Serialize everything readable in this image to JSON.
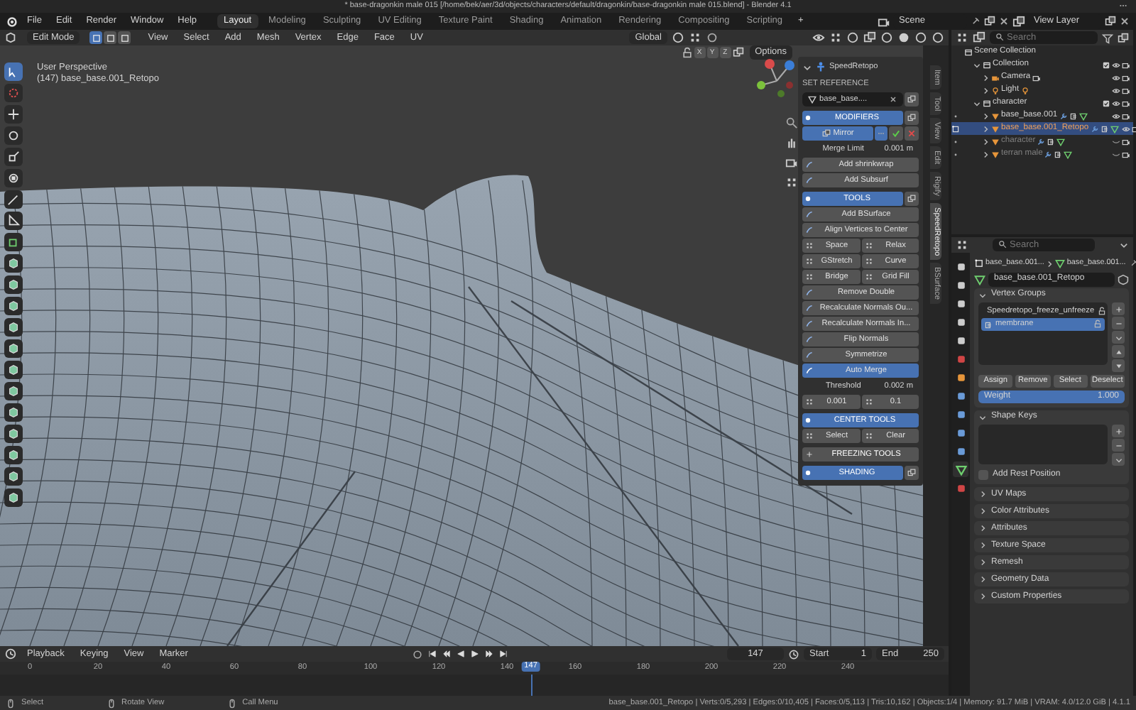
{
  "window": {
    "title": "* base-dragonkin male 015 [/home/bek/aer/3d/objects/characters/default/dragonkin/base-dragonkin male 015.blend] - Blender 4.1"
  },
  "menu": [
    "File",
    "Edit",
    "Render",
    "Window",
    "Help"
  ],
  "workspaces": [
    {
      "label": "Layout",
      "selected": true
    },
    {
      "label": "Modeling",
      "selected": false
    },
    {
      "label": "Sculpting",
      "selected": false
    },
    {
      "label": "UV Editing",
      "selected": false
    },
    {
      "label": "Texture Paint",
      "selected": false
    },
    {
      "label": "Shading",
      "selected": false
    },
    {
      "label": "Animation",
      "selected": false
    },
    {
      "label": "Rendering",
      "selected": false
    },
    {
      "label": "Compositing",
      "selected": false
    },
    {
      "label": "Scripting",
      "selected": false
    }
  ],
  "add_workspace": "+",
  "scene": {
    "scene": "Scene",
    "view_layer": "View Layer"
  },
  "viewport": {
    "mode": "Edit Mode",
    "select_modes": [
      {
        "selected": true
      },
      {
        "selected": false
      },
      {
        "selected": false
      }
    ],
    "menus": [
      "View",
      "Select",
      "Add",
      "Mesh",
      "Vertex",
      "Edge",
      "Face",
      "UV"
    ],
    "orientation": "Global",
    "axes": [
      "X",
      "Y",
      "Z"
    ],
    "options": "Options",
    "view_name": "User Perspective",
    "object_info": "(147) base_base.001_Retopo",
    "tools": [
      {
        "kind": "select",
        "selected": true
      },
      {
        "kind": "cursor",
        "selected": false
      },
      {
        "kind": "move",
        "selected": false
      },
      {
        "kind": "rotate",
        "selected": false
      },
      {
        "kind": "scale",
        "selected": false
      },
      {
        "kind": "transform",
        "selected": false
      },
      {
        "kind": "annotate",
        "selected": false
      },
      {
        "kind": "measure",
        "selected": false
      },
      {
        "kind": "add_cube",
        "selected": false
      },
      {
        "kind": "extrude",
        "selected": false
      },
      {
        "kind": "inset",
        "selected": false
      },
      {
        "kind": "bevel",
        "selected": false
      },
      {
        "kind": "loop_cut",
        "selected": false
      },
      {
        "kind": "knife",
        "selected": false
      },
      {
        "kind": "poly_build",
        "selected": false
      },
      {
        "kind": "spin",
        "selected": false
      },
      {
        "kind": "smooth",
        "selected": false
      },
      {
        "kind": "edge_slide",
        "selected": false
      },
      {
        "kind": "shrink",
        "selected": false
      },
      {
        "kind": "shear",
        "selected": false
      },
      {
        "kind": "rip",
        "selected": false
      }
    ]
  },
  "speedretopo": {
    "title": "SpeedRetopo",
    "rows": [
      {
        "kind": "heading",
        "text": "SET REFERENCE"
      },
      {
        "kind": "field",
        "value": "base_base...."
      },
      {
        "kind": "section",
        "text": "MODIFIERS",
        "active": true,
        "side_button": true
      },
      {
        "kind": "mirror",
        "text": "Mirror"
      },
      {
        "kind": "value",
        "label": "Merge Limit",
        "value": "0.001 m"
      },
      {
        "kind": "button",
        "text": "Add shrinkwrap"
      },
      {
        "kind": "button",
        "text": "Add Subsurf"
      },
      {
        "kind": "section",
        "text": "TOOLS",
        "active": true,
        "side_button": true
      },
      {
        "kind": "button",
        "text": "Add BSurface"
      },
      {
        "kind": "button",
        "text": "Align Vertices to Center"
      },
      {
        "kind": "pair",
        "items": [
          "Space",
          "Relax"
        ]
      },
      {
        "kind": "pair",
        "items": [
          "GStretch",
          "Curve"
        ]
      },
      {
        "kind": "pair",
        "items": [
          "Bridge",
          "Grid Fill"
        ]
      },
      {
        "kind": "button",
        "text": "Remove Double"
      },
      {
        "kind": "button",
        "text": "Recalculate Normals Ou..."
      },
      {
        "kind": "button",
        "text": "Recalculate Normals In..."
      },
      {
        "kind": "button",
        "text": "Flip Normals"
      },
      {
        "kind": "button",
        "text": "Symmetrize"
      },
      {
        "kind": "toggle",
        "text": "Auto Merge",
        "on": true
      },
      {
        "kind": "value",
        "label": "Threshold",
        "value": "0.002 m"
      },
      {
        "kind": "pair",
        "items": [
          "0.001",
          "0.1"
        ]
      },
      {
        "kind": "section",
        "text": "CENTER TOOLS",
        "active": true,
        "side_button": false
      },
      {
        "kind": "pair",
        "items": [
          "Select",
          "Clear"
        ]
      },
      {
        "kind": "section",
        "text": "FREEZING TOOLS",
        "active": false,
        "side_button": false
      },
      {
        "kind": "section",
        "text": "SHADING",
        "active": true,
        "side_button": true
      }
    ]
  },
  "sidebar_tabs": [
    {
      "label": "Item",
      "selected": false
    },
    {
      "label": "Tool",
      "selected": false
    },
    {
      "label": "View",
      "selected": false
    },
    {
      "label": "Edit",
      "selected": false
    },
    {
      "label": "Rigify",
      "selected": false
    },
    {
      "label": "SpeedRetopo",
      "selected": true
    },
    {
      "label": "BSurface",
      "selected": false
    }
  ],
  "outliner": {
    "search_placeholder": "Search",
    "tree": [
      {
        "label": "Scene Collection",
        "kind": "scene",
        "children": [
          {
            "label": "Collection",
            "kind": "collection",
            "expanded": true,
            "children": [
              {
                "label": "Camera",
                "kind": "camera",
                "selected": false,
                "hidden": false
              },
              {
                "label": "Light",
                "kind": "light",
                "selected": false,
                "hidden": false
              }
            ]
          },
          {
            "label": "character",
            "kind": "collection",
            "expanded": true,
            "children": [
              {
                "label": "base_base.001",
                "kind": "mesh",
                "selected": false,
                "hidden": false,
                "edit_mode": false
              },
              {
                "label": "base_base.001_Retopo",
                "kind": "mesh",
                "selected": true,
                "hidden": false,
                "edit_mode": true
              },
              {
                "label": "character",
                "kind": "mesh",
                "selected": false,
                "hidden": true,
                "edit_mode": false
              },
              {
                "label": "terran male",
                "kind": "mesh",
                "selected": false,
                "hidden": true,
                "edit_mode": false
              }
            ]
          }
        ]
      }
    ]
  },
  "properties": {
    "search_placeholder": "Search",
    "breadcrumb": [
      "base_base.001...",
      "base_base.001..."
    ],
    "mesh_name": "base_base.001_Retopo",
    "tabs": [
      {
        "kind": "tool",
        "selected": false
      },
      {
        "kind": "render",
        "selected": false
      },
      {
        "kind": "output",
        "selected": false
      },
      {
        "kind": "view_layer",
        "selected": false
      },
      {
        "kind": "scene",
        "selected": false
      },
      {
        "kind": "world",
        "selected": false
      },
      {
        "kind": "object",
        "selected": false
      },
      {
        "kind": "modifier",
        "selected": false
      },
      {
        "kind": "particles",
        "selected": false
      },
      {
        "kind": "physics",
        "selected": false
      },
      {
        "kind": "constraints",
        "selected": false
      },
      {
        "kind": "data",
        "selected": true
      },
      {
        "kind": "material",
        "selected": false
      }
    ],
    "vertex_groups": {
      "title": "Vertex Groups",
      "expanded": true,
      "items": [
        {
          "label": "Speedretopo_freeze_unfreeze",
          "selected": false
        },
        {
          "label": "membrane",
          "selected": true
        }
      ],
      "buttons": [
        "Assign",
        "Remove",
        "Select",
        "Deselect"
      ],
      "weight_label": "Weight",
      "weight": "1.000",
      "level": 1
    },
    "shape_keys": {
      "title": "Shape Keys",
      "expanded": true,
      "rest_label": "Add Rest Position",
      "rest_checked": false
    },
    "panels": [
      {
        "title": "UV Maps",
        "expanded": false
      },
      {
        "title": "Color Attributes",
        "expanded": false
      },
      {
        "title": "Attributes",
        "expanded": false
      },
      {
        "title": "Texture Space",
        "expanded": false
      },
      {
        "title": "Remesh",
        "expanded": false
      },
      {
        "title": "Geometry Data",
        "expanded": false
      },
      {
        "title": "Custom Properties",
        "expanded": false
      }
    ]
  },
  "timeline": {
    "menus": [
      "Playback",
      "Keying",
      "View",
      "Marker"
    ],
    "current_frame": "147",
    "start_label": "Start",
    "start": "1",
    "end_label": "End",
    "end": "250",
    "ruler": [
      "0",
      "20",
      "40",
      "60",
      "80",
      "100",
      "120",
      "140",
      "160",
      "180",
      "200",
      "220",
      "240"
    ],
    "playhead": "147"
  },
  "status_bar": {
    "hints": [
      "Select",
      "Rotate View",
      "Call Menu"
    ],
    "stats": "base_base.001_Retopo | Verts:0/5,293 | Edges:0/10,405 | Faces:0/5,113 | Tris:10,162 | Objects:1/4 | Memory: 91.7 MiB | VRAM: 4.0/12.0 GiB | 4.1.1"
  }
}
